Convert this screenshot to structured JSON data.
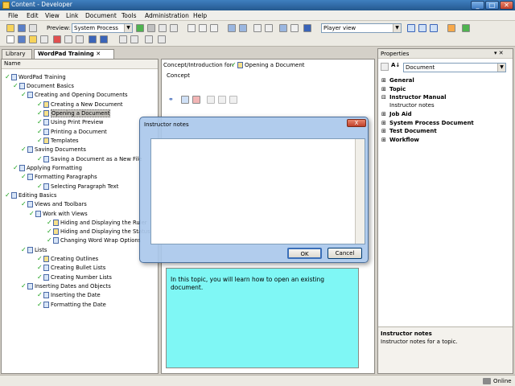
{
  "window": {
    "title": "Content - Developer",
    "min": "_",
    "max": "□",
    "close": "✕"
  },
  "menu": [
    "File",
    "Edit",
    "View",
    "Link",
    "Document",
    "Tools",
    "Administration",
    "Help"
  ],
  "toolbar": {
    "preview_label": "Preview:",
    "preview_value": "System Process",
    "view_value": "Player view"
  },
  "tabs": {
    "library": "Library",
    "wordpad": "WordPad Training"
  },
  "tree": {
    "column": "Name",
    "items": [
      {
        "text": "WordPad Training"
      },
      {
        "text": "Document Basics"
      },
      {
        "text": "Creating and Opening Documents"
      },
      {
        "text": "Creating a New Document"
      },
      {
        "text": "Opening a Document"
      },
      {
        "text": "Using Print Preview"
      },
      {
        "text": "Printing a Document"
      },
      {
        "text": "Templates"
      },
      {
        "text": "Saving Documents"
      },
      {
        "text": "Saving a Document as a New File"
      },
      {
        "text": "Applying Formatting"
      },
      {
        "text": "Formatting Paragraphs"
      },
      {
        "text": "Selecting Paragraph Text"
      },
      {
        "text": "Editing Basics"
      },
      {
        "text": "Views and Toolbars"
      },
      {
        "text": "Work with Views"
      },
      {
        "text": "Hiding and Displaying the Ruler"
      },
      {
        "text": "Hiding and Displaying the Status"
      },
      {
        "text": "Changing Word Wrap Options"
      },
      {
        "text": "Lists"
      },
      {
        "text": "Creating Outlines"
      },
      {
        "text": "Creating Bullet Lists"
      },
      {
        "text": "Creating Number Lists"
      },
      {
        "text": "Inserting Dates and Objects"
      },
      {
        "text": "Inserting the Date"
      },
      {
        "text": "Formatting the Date"
      }
    ]
  },
  "center": {
    "header_label": "Concept/Introduction for:",
    "header_doc": "Opening a Document",
    "concept_label": "Concept",
    "body_text": "In this topic, you will learn how to open an existing document."
  },
  "properties": {
    "title": "Properties",
    "pin": "▾ ✕",
    "sort": "A↓",
    "selector": "Document",
    "groups": [
      "General",
      "Topic",
      "Instructor Manual",
      "Job Aid",
      "System Process Document",
      "Test Document",
      "Workflow"
    ],
    "instructor_notes_row": "Instructor notes",
    "desc_title": "Instructor notes",
    "desc_text": "Instructor notes for a topic."
  },
  "dialog": {
    "title": "Instructor notes",
    "ok": "OK",
    "cancel": "Cancel",
    "close": "X"
  },
  "status": {
    "online": "Online"
  }
}
